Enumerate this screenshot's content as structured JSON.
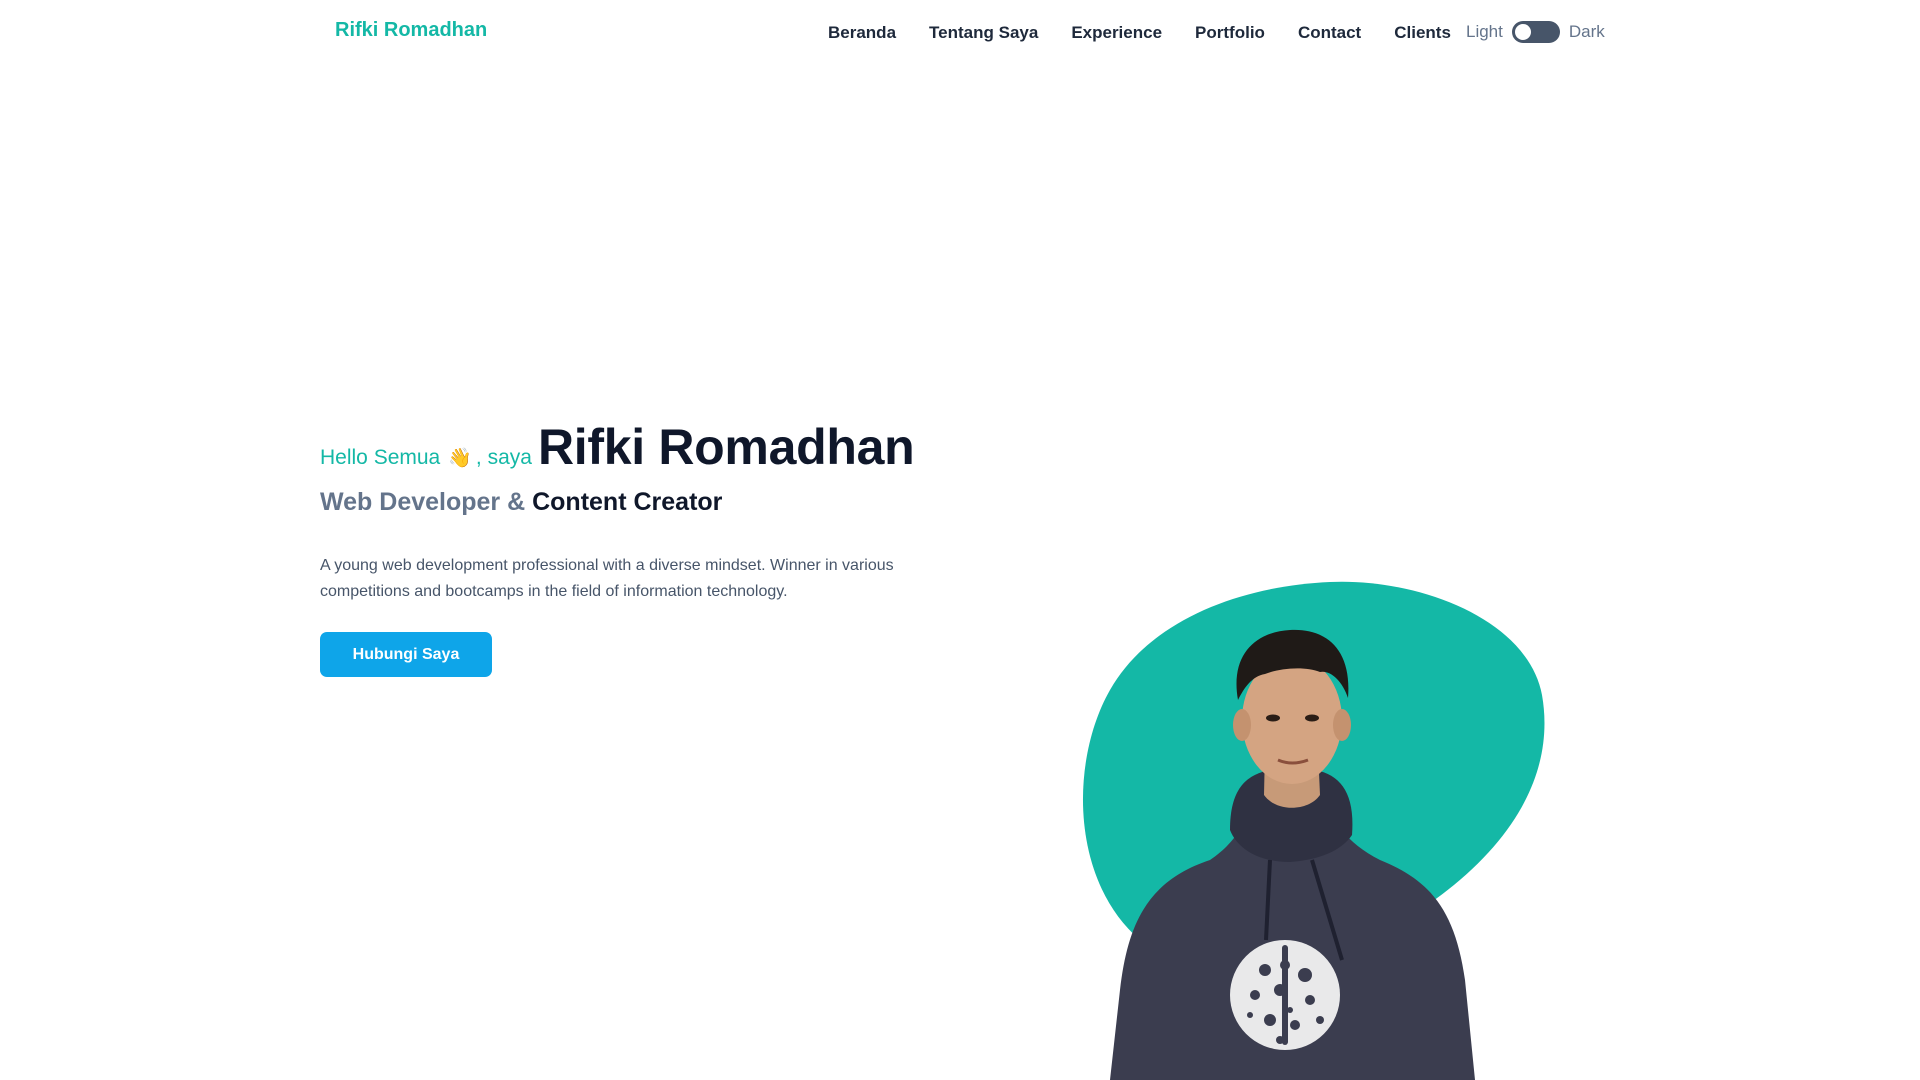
{
  "header": {
    "brand": "Rifki Romadhan",
    "nav": [
      {
        "label": "Beranda"
      },
      {
        "label": "Tentang Saya"
      },
      {
        "label": "Experience"
      },
      {
        "label": "Portfolio"
      },
      {
        "label": "Contact"
      },
      {
        "label": "Clients"
      }
    ],
    "theme": {
      "light_label": "Light",
      "dark_label": "Dark",
      "dark_mode": false
    }
  },
  "hero": {
    "greeting": "Hello Semua",
    "wave_emoji": "👋",
    "greeting_suffix": ", saya",
    "name": "Rifki Romadhan",
    "role_part1": "Web Developer &",
    "role_part2": "Content Creator",
    "description": "A young web development professional with a diverse mindset. Winner in various competitions and bootcamps in the field of information technology.",
    "cta_label": "Hubungi Saya"
  },
  "colors": {
    "accent": "#14b8a6",
    "button": "#0ea5e9",
    "heading": "#0f172a",
    "muted": "#64748b"
  }
}
